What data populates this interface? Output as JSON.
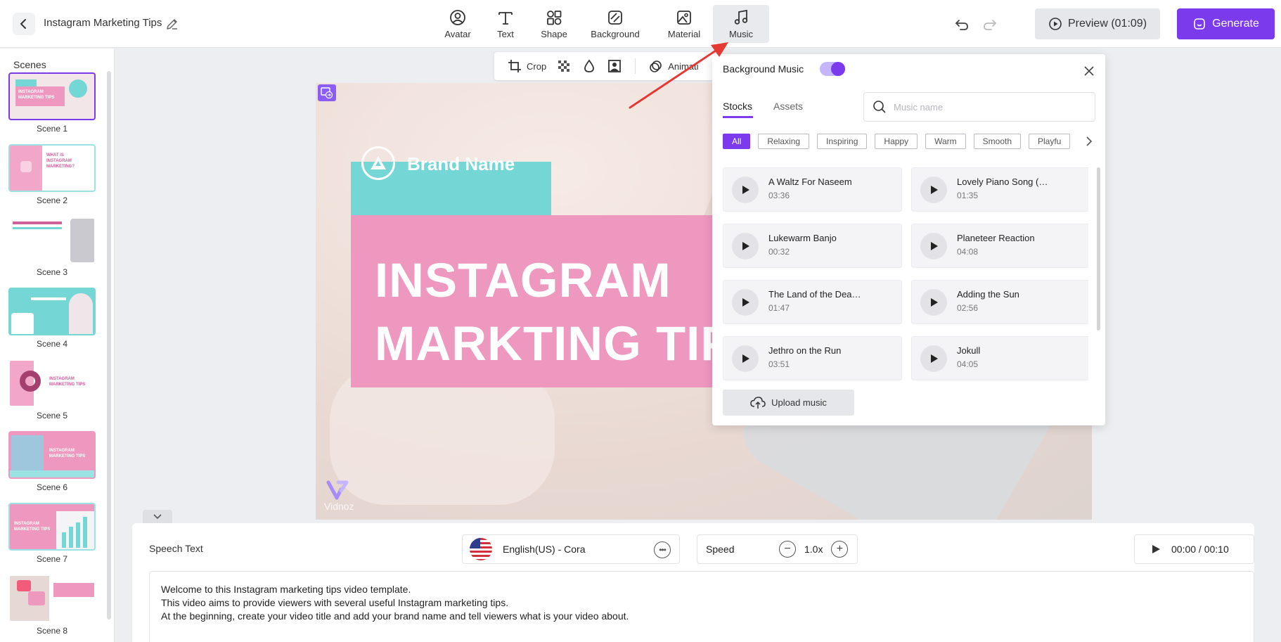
{
  "header": {
    "project_title": "Instagram Marketing Tips",
    "tools": [
      {
        "label": "Avatar",
        "icon": "avatar-icon"
      },
      {
        "label": "Text",
        "icon": "text-icon"
      },
      {
        "label": "Shape",
        "icon": "shape-icon"
      },
      {
        "label": "Background",
        "icon": "background-icon"
      },
      {
        "label": "Material",
        "icon": "material-icon"
      },
      {
        "label": "Music",
        "icon": "music-icon",
        "active": true
      }
    ],
    "preview_label": "Preview (01:09)",
    "generate_label": "Generate"
  },
  "sidebar": {
    "title": "Scenes",
    "scenes": [
      {
        "label": "Scene 1",
        "active": true
      },
      {
        "label": "Scene 2"
      },
      {
        "label": "Scene 3"
      },
      {
        "label": "Scene 4"
      },
      {
        "label": "Scene 5"
      },
      {
        "label": "Scene 6"
      },
      {
        "label": "Scene 7"
      },
      {
        "label": "Scene 8"
      }
    ]
  },
  "crop_toolbar": {
    "crop_label": "Crop",
    "animation_label": "Animati"
  },
  "canvas": {
    "brand_name": "Brand Name",
    "title_line1": "INSTAGRAM",
    "title_line2": "MARKTING TIPS",
    "watermark": "Vidnoz"
  },
  "speech": {
    "label": "Speech Text",
    "voice": "English(US) - Cora",
    "speed_label": "Speed",
    "speed_value": "1.0x",
    "time": "00:00 / 00:10",
    "text_lines": [
      "Welcome to this Instagram marketing tips video template.",
      "This video aims to provide viewers with several useful Instagram marketing tips.",
      "At the beginning, create your video title and add your brand name and tell viewers what is your video about."
    ]
  },
  "music_panel": {
    "title": "Background Music",
    "enabled": true,
    "tabs": [
      "Stocks",
      "Assets"
    ],
    "active_tab": "Stocks",
    "search_placeholder": "Music name",
    "categories": [
      "All",
      "Relaxing",
      "Inspiring",
      "Happy",
      "Warm",
      "Smooth",
      "Playfu"
    ],
    "active_category": "All",
    "tracks": [
      {
        "name": "A Waltz For Naseem",
        "duration": "03:36"
      },
      {
        "name": "Lovely Piano Song (…",
        "duration": "01:35"
      },
      {
        "name": "Lukewarm Banjo",
        "duration": "00:32"
      },
      {
        "name": "Planeteer Reaction",
        "duration": "04:08"
      },
      {
        "name": "The Land of the Dea…",
        "duration": "01:47"
      },
      {
        "name": "Adding the Sun",
        "duration": "02:56"
      },
      {
        "name": "Jethro on the Run",
        "duration": "03:51"
      },
      {
        "name": "Jokull",
        "duration": "04:05"
      }
    ],
    "upload_label": "Upload music"
  },
  "colors": {
    "accent": "#7c3aed",
    "brand_teal": "#75d6d6",
    "title_pink": "#ee97bf",
    "arrow_red": "#e53935"
  }
}
